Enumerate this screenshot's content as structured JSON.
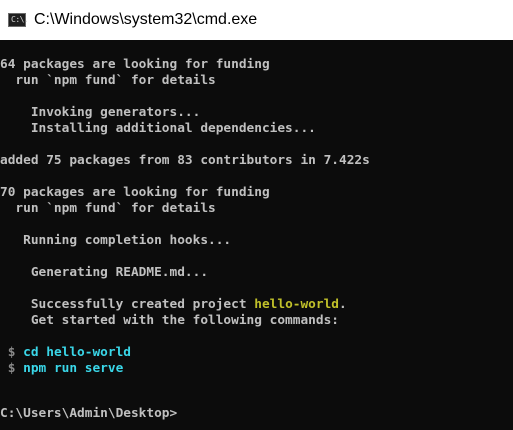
{
  "window": {
    "title": "C:\\Windows\\system32\\cmd.exe",
    "icon": "cmd-icon",
    "icon_glyph": "C:\\."
  },
  "colors": {
    "background": "#0c0c0c",
    "text": "#c0c0c0",
    "highlight": "#c1c12a",
    "command": "#3ad7e9"
  },
  "console": {
    "funding1": "64 packages are looking for funding",
    "fund_hint1": "  run `npm fund` for details",
    "invoking": "    Invoking generators...",
    "installing": "    Installing additional dependencies...",
    "added": "added 75 packages from 83 contributors in 7.422s",
    "funding2": "70 packages are looking for funding",
    "fund_hint2": "  run `npm fund` for details",
    "completion": "   Running completion hooks...",
    "readme": "    Generating README.md...",
    "created_prefix": "    Successfully created project ",
    "project_name": "hello-world",
    "created_suffix": ".",
    "get_started": "    Get started with the following commands:",
    "cmd1_prompt": " $ ",
    "cmd1": "cd hello-world",
    "cmd2_prompt": " $ ",
    "cmd2": "npm run serve",
    "prompt": "C:\\Users\\Admin\\Desktop>"
  }
}
